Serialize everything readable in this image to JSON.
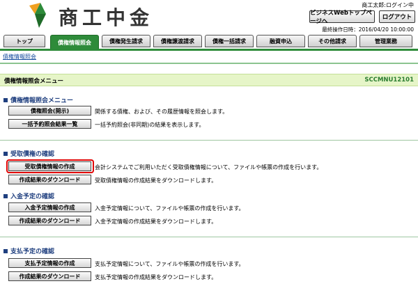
{
  "brand": "商工中金",
  "header": {
    "user_info": "商工太郎:ログイン中",
    "webtop_button": "ビジネスWebトップページへ",
    "logout_button": "ログアウト",
    "last_operation": "最終操作日時：2016/04/20 10:00:00"
  },
  "tabs": [
    {
      "label": "トップ"
    },
    {
      "label": "債権情報照会"
    },
    {
      "label": "債権発生請求"
    },
    {
      "label": "債権譲渡請求"
    },
    {
      "label": "債権一括請求"
    },
    {
      "label": "融資申込"
    },
    {
      "label": "その他請求"
    },
    {
      "label": "管理業務"
    }
  ],
  "subnav": "債権情報照会",
  "title_bar": {
    "title": "債権情報照会メニュー",
    "screen_id": "SCCMNU12101"
  },
  "sections": [
    {
      "title": "債権情報照会メニュー",
      "items": [
        {
          "button": "債権照会(開示)",
          "desc": "関係する債権、および、その履歴情報を照会します。"
        },
        {
          "button": "一括予約照会結果一覧",
          "desc": "一括予約照会(非同期)の結果を表示します。"
        }
      ]
    },
    {
      "title": "受取債権の確認",
      "items": [
        {
          "button": "受取債権情報の作成",
          "desc": "会計システムでご利用いただく受取債権情報について、ファイルや帳票の作成を行います。"
        },
        {
          "button": "作成結果のダウンロード",
          "desc": "受取債権情報の作成結果をダウンロードします。"
        }
      ]
    },
    {
      "title": "入金予定の確認",
      "items": [
        {
          "button": "入金予定情報の作成",
          "desc": "入金予定情報について、ファイルや帳票の作成を行います。"
        },
        {
          "button": "作成結果のダウンロード",
          "desc": "入金予定情報の作成結果をダウンロードします。"
        }
      ]
    },
    {
      "title": "支払予定の確認",
      "items": [
        {
          "button": "支払予定情報の作成",
          "desc": "支払予定情報について、ファイルや帳票の作成を行います。"
        },
        {
          "button": "作成結果のダウンロード",
          "desc": "支払予定情報の作成結果をダウンロードします。"
        }
      ]
    }
  ]
}
